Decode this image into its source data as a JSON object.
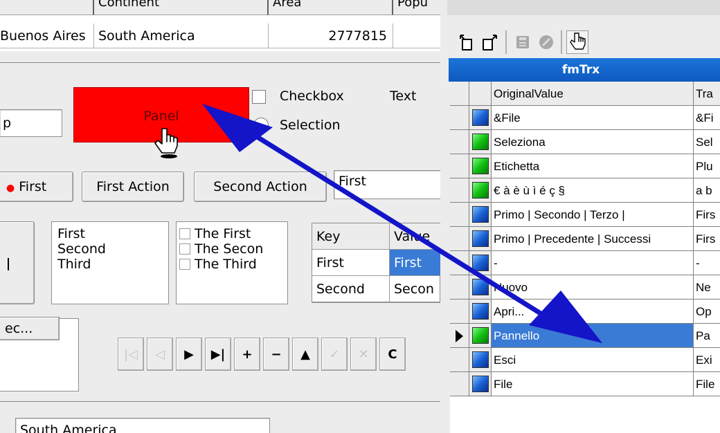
{
  "top_grid": {
    "headers": [
      "Continent",
      "Area",
      "Popu"
    ],
    "row": {
      "capital": "Buenos Aires",
      "continent": "South America",
      "area": "2777815"
    }
  },
  "panel": {
    "label": "Panel",
    "color": "#ff0000"
  },
  "checkbox_label": "Checkbox",
  "selection_label": "Selection",
  "text_label": "Text",
  "edit_value": "p",
  "buttons": {
    "first": "First",
    "first_action": "First Action",
    "second_action": "Second Action"
  },
  "combo_value": "First",
  "listbox": [
    "First",
    "Second",
    "Third"
  ],
  "check_list": [
    "The First",
    "The Secon",
    "The Third"
  ],
  "kv_grid": {
    "headers": [
      "Key",
      "Value"
    ],
    "rows": [
      [
        "First",
        "First"
      ],
      [
        "Second",
        "Secon"
      ]
    ]
  },
  "tab_label": "ec...",
  "bottom_edit": "South America",
  "navigator": {
    "buttons": [
      {
        "icon": "first-icon",
        "glyph": "|◁",
        "enabled": false
      },
      {
        "icon": "prior-icon",
        "glyph": "◁",
        "enabled": false
      },
      {
        "icon": "next-icon",
        "glyph": "▶",
        "enabled": true
      },
      {
        "icon": "last-icon",
        "glyph": "▶|",
        "enabled": true
      },
      {
        "icon": "insert-icon",
        "glyph": "+",
        "enabled": true
      },
      {
        "icon": "delete-icon",
        "glyph": "−",
        "enabled": true
      },
      {
        "icon": "edit-icon",
        "glyph": "▲",
        "enabled": true
      },
      {
        "icon": "post-icon",
        "glyph": "✓",
        "enabled": false
      },
      {
        "icon": "cancel-icon",
        "glyph": "✕",
        "enabled": false
      },
      {
        "icon": "refresh-icon",
        "glyph": "C",
        "enabled": true
      }
    ]
  },
  "translator": {
    "title": "fmTrx",
    "headers": [
      "OriginalValue",
      "Tra"
    ],
    "rows": [
      {
        "flag": "blue",
        "original": "&File",
        "translation": "&Fi"
      },
      {
        "flag": "green",
        "original": "Seleziona",
        "translation": "Sel"
      },
      {
        "flag": "green",
        "original": "Etichetta",
        "translation": "Plu"
      },
      {
        "flag": "green",
        "original": "€ à è ù ì é ç §",
        "translation": "a b"
      },
      {
        "flag": "blue",
        "original": "Primo | Secondo | Terzo |",
        "translation": "Firs"
      },
      {
        "flag": "blue",
        "original": "Primo | Precedente | Successi",
        "translation": "Firs"
      },
      {
        "flag": "blue",
        "original": "-",
        "translation": "-"
      },
      {
        "flag": "blue",
        "original": "Nuovo",
        "translation": "Ne"
      },
      {
        "flag": "blue",
        "original": "Apri...",
        "translation": "Op"
      },
      {
        "flag": "green",
        "original": "Pannello",
        "translation": "Pa",
        "selected": true
      },
      {
        "flag": "blue",
        "original": "Esci",
        "translation": "Exi"
      },
      {
        "flag": "blue",
        "original": "File",
        "translation": "File"
      }
    ]
  },
  "colors": {
    "arrow": "#1414c8",
    "selection": "#3a7bd5",
    "title_bar": "#0d59c0",
    "window_border": "#7584cf"
  }
}
